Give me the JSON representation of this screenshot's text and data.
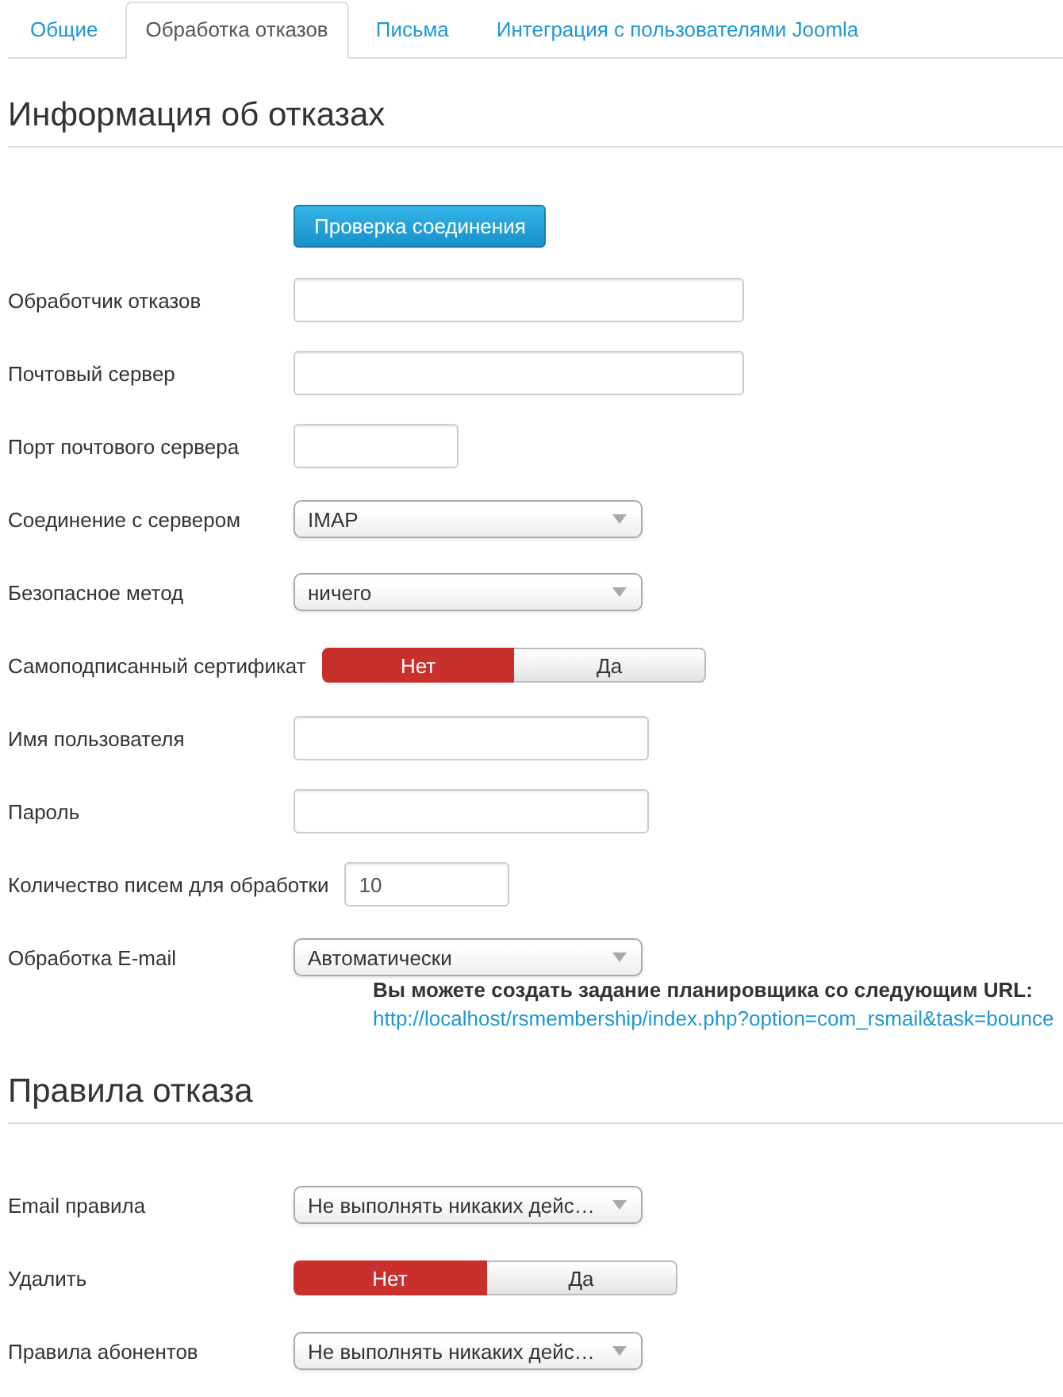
{
  "tabs": [
    {
      "label": "Общие",
      "selected": false
    },
    {
      "label": "Обработка отказов",
      "selected": true
    },
    {
      "label": "Письма",
      "selected": false
    },
    {
      "label": "Интеграция с пользователями Joomla",
      "selected": false
    }
  ],
  "sections": [
    {
      "title": "Информация об отказах",
      "button": "Проверка соединения",
      "fields": [
        {
          "kind": "text",
          "label": "Обработчик отказов"
        },
        {
          "kind": "text",
          "label": "Почтовый сервер"
        },
        {
          "kind": "text",
          "label": "Порт почтового сервера"
        },
        {
          "kind": "select",
          "label": "Соединение с сервером",
          "value": "IMAP"
        },
        {
          "kind": "select",
          "label": "Безопасное метод",
          "value": "ничего"
        },
        {
          "kind": "toggle",
          "label": "Самоподписанный сертификат",
          "options": [
            {
              "label": "Нет",
              "selected": true
            },
            {
              "label": "Да",
              "selected": false
            }
          ]
        },
        {
          "kind": "text",
          "label": "Имя пользователя"
        },
        {
          "kind": "password",
          "label": "Пароль"
        },
        {
          "kind": "text",
          "label": "Количество писем для обработки",
          "value": "10"
        },
        {
          "kind": "select",
          "label": "Обработка E-mail",
          "value": "Автоматически",
          "note": {
            "text": "Вы можете создать задание планировщика со следующим URL:",
            "link": "http://localhost/rsmembership/index.php?option=com_rsmail&task=bounce"
          }
        }
      ]
    },
    {
      "title": "Правила отказа",
      "fields": [
        {
          "kind": "select",
          "label": "Email правила",
          "value": "Не выполнять никаких дейс…"
        },
        {
          "kind": "toggle",
          "label": "Удалить",
          "options": [
            {
              "label": "Нет",
              "selected": true
            },
            {
              "label": "Да",
              "selected": false
            }
          ]
        },
        {
          "kind": "select",
          "label": "Правила абонентов",
          "value": "Не выполнять никаких дейс…"
        }
      ]
    }
  ]
}
